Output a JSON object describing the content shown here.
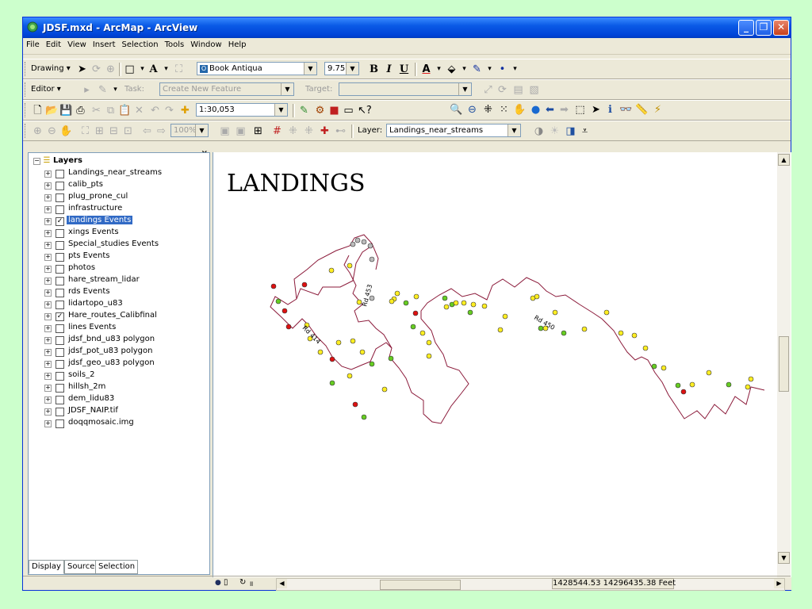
{
  "window": {
    "title": "JDSF.mxd - ArcMap - ArcView"
  },
  "menu": [
    "File",
    "Edit",
    "View",
    "Insert",
    "Selection",
    "Tools",
    "Window",
    "Help"
  ],
  "drawing_toolbar": {
    "label": "Drawing",
    "font": "Book Antiqua",
    "font_size": "9.75",
    "bold": "B",
    "italic": "I",
    "underline": "U"
  },
  "editor_toolbar": {
    "label": "Editor",
    "task_label": "Task:",
    "task_value": "Create New Feature",
    "target_label": "Target:",
    "target_value": ""
  },
  "standard_toolbar": {
    "scale": "1:30,053"
  },
  "layout_toolbar": {
    "zoom": "100%",
    "layer_label": "Layer:",
    "layer_value": "Landings_near_streams"
  },
  "toc": {
    "root": "Layers",
    "layers": [
      {
        "name": "Landings_near_streams",
        "checked": false,
        "selected": false
      },
      {
        "name": "calib_pts",
        "checked": false,
        "selected": false
      },
      {
        "name": "plug_prone_cul",
        "checked": false,
        "selected": false
      },
      {
        "name": "infrastructure",
        "checked": false,
        "selected": false
      },
      {
        "name": "landings Events",
        "checked": true,
        "selected": true
      },
      {
        "name": "xings Events",
        "checked": false,
        "selected": false
      },
      {
        "name": "Special_studies Events",
        "checked": false,
        "selected": false
      },
      {
        "name": "pts Events",
        "checked": false,
        "selected": false
      },
      {
        "name": "photos",
        "checked": false,
        "selected": false
      },
      {
        "name": "hare_stream_lidar",
        "checked": false,
        "selected": false
      },
      {
        "name": "rds Events",
        "checked": false,
        "selected": false
      },
      {
        "name": "lidartopo_u83",
        "checked": false,
        "selected": false
      },
      {
        "name": "Hare_routes_Calibfinal",
        "checked": true,
        "selected": false
      },
      {
        "name": "lines Events",
        "checked": false,
        "selected": false
      },
      {
        "name": "jdsf_bnd_u83 polygon",
        "checked": false,
        "selected": false
      },
      {
        "name": "jdsf_pot_u83 polygon",
        "checked": false,
        "selected": false
      },
      {
        "name": "jdsf_geo_u83 polygon",
        "checked": false,
        "selected": false
      },
      {
        "name": "soils_2",
        "checked": false,
        "selected": false
      },
      {
        "name": "hillsh_2m",
        "checked": false,
        "selected": false
      },
      {
        "name": "dem_lidu83",
        "checked": false,
        "selected": false
      },
      {
        "name": "JDSF_NAIP.tif",
        "checked": false,
        "selected": false
      },
      {
        "name": "doqqmosaic.img",
        "checked": false,
        "selected": false
      }
    ],
    "tabs": [
      "Display",
      "Source",
      "Selection"
    ]
  },
  "map": {
    "title": "LANDINGS",
    "road_labels": [
      "Rd 453",
      "Rd 414",
      "Rd 450"
    ],
    "colors": {
      "route": "#8b1a3a",
      "red": "#dd1111",
      "green": "#66cc22",
      "yellow": "#ffee22",
      "gray": "#bbbbbb"
    }
  },
  "status": {
    "coords": "1428544.53 14296435.38 Feet"
  }
}
